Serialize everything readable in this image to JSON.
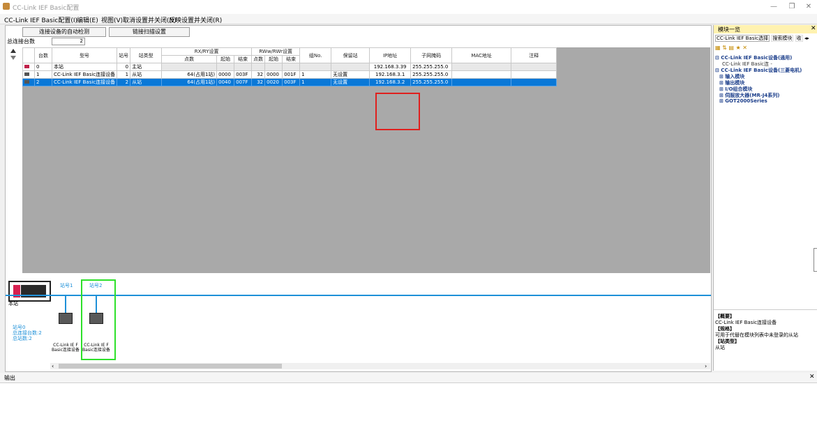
{
  "window": {
    "title": "CC-Link IEF Basic配置"
  },
  "menu": [
    "CC-Link IEF Basic配置(I)",
    "编辑(E)",
    "视图(V)",
    "取消设置并关闭(N)",
    "反映设置并关闭(R)"
  ],
  "toolbar": {
    "auto_detect_label": "连接设备的自动检测",
    "link_scan_label": "链接扫描设置",
    "total_count_label": "总连接台数",
    "total_count_value": "2"
  },
  "table": {
    "headers": {
      "count": "台数",
      "model": "型号",
      "station_no": "站号",
      "station_type": "站类型",
      "rx_group": "RX/RY设置",
      "rwr_group": "RWw/RWr设置",
      "points": "点数",
      "start": "起始",
      "end": "结束",
      "group_no": "组No.",
      "reserved": "保留站",
      "ip": "IP地址",
      "subnet": "子网掩码",
      "mac": "MAC地址",
      "comment": "注释"
    },
    "rows": [
      {
        "count": "0",
        "model": "本站",
        "station_no": "0",
        "station_type": "主站",
        "rx_points": "",
        "rx_start": "",
        "rx_end": "",
        "rw_points": "",
        "rw_start": "",
        "rw_end": "",
        "group_no": "",
        "reserved": "",
        "ip": "192.168.3.39",
        "subnet": "255.255.255.0",
        "mac": "",
        "comment": ""
      },
      {
        "count": "1",
        "model": "CC-Link IEF Basic连接设备",
        "station_no": "1",
        "station_type": "从站",
        "rx_points": "64(占用1站)",
        "rx_start": "0000",
        "rx_end": "003F",
        "rw_points": "32",
        "rw_start": "0000",
        "rw_end": "001F",
        "group_no": "1",
        "reserved": "无设置",
        "ip": "192.168.3.1",
        "subnet": "255.255.255.0",
        "mac": "",
        "comment": ""
      },
      {
        "count": "2",
        "model": "CC-Link IEF Basic连接设备",
        "station_no": "2",
        "station_type": "从站",
        "rx_points": "64(占用1站)",
        "rx_start": "0040",
        "rx_end": "007F",
        "rw_points": "32",
        "rw_start": "0020",
        "rw_end": "003F",
        "group_no": "1",
        "reserved": "无设置",
        "ip": "192.168.3.2",
        "subnet": "255.255.255.0",
        "mac": "",
        "comment": ""
      }
    ]
  },
  "diagram": {
    "master_label": "本站",
    "station1_label": "站号1",
    "station2_label": "站号2",
    "info_line1": "站号0",
    "info_line2": "总连接台数:2",
    "info_line3": "总站数:2",
    "device1_label": "CC-Link IE F Basic连接设备",
    "device2_label": "CC-Link IE F Basic连接设备"
  },
  "right_panel": {
    "title": "模块一览",
    "tabs": [
      "CC-Link IEF Basic选择",
      "搜索模块",
      "收"
    ],
    "tree": [
      "⊟ CC-Link IEF Basic设备(通用)",
      "CC-Link IEF Basic连 -",
      "⊟ CC-Link IEF Basic设备(三菱电机)",
      "⊞ 输入模块",
      "⊞ 输出模块",
      "⊞ I/O组合模块",
      "⊞ 伺服放大器(MR-J4系列)",
      "⊞ GOT2000Series"
    ],
    "desc": {
      "overview_label": "【概要】",
      "overview": "CC-Link IEF Basic连接设备",
      "spec_label": "【规格】",
      "spec": "可用于代替在模块列表中未登录的从站",
      "type_label": "【站类型】",
      "type": "从站"
    }
  },
  "output": {
    "title": "输出"
  },
  "colors": {
    "selection": "#0a78d7",
    "highlight_red": "#e0201e",
    "highlight_green": "#2ee02a",
    "station_blue": "#1e90d8"
  }
}
